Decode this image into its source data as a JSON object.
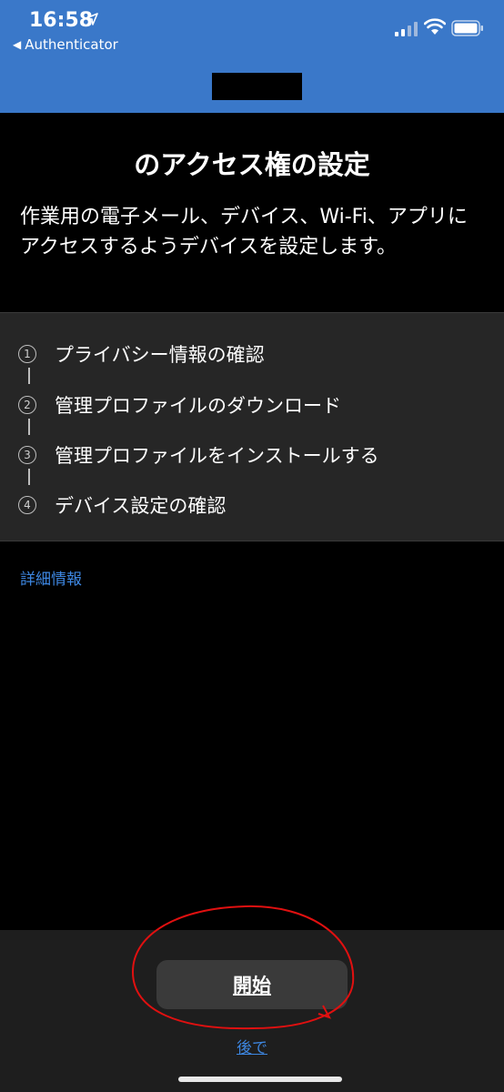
{
  "status_bar": {
    "time": "16:58",
    "back_app": "Authenticator",
    "accent_color": "#3a78c9"
  },
  "main": {
    "title": "のアクセス権の設定",
    "description": "作業用の電子メール、デバイス、Wi-Fi、アプリにアクセスするようデバイスを設定します。",
    "steps": [
      {
        "num": "1",
        "label": "プライバシー情報の確認"
      },
      {
        "num": "2",
        "label": "管理プロファイルのダウンロード"
      },
      {
        "num": "3",
        "label": "管理プロファイルをインストールする"
      },
      {
        "num": "4",
        "label": "デバイス設定の確認"
      }
    ],
    "more_info_link": "詳細情報"
  },
  "footer": {
    "start_button": "開始",
    "later_link": "後で"
  }
}
